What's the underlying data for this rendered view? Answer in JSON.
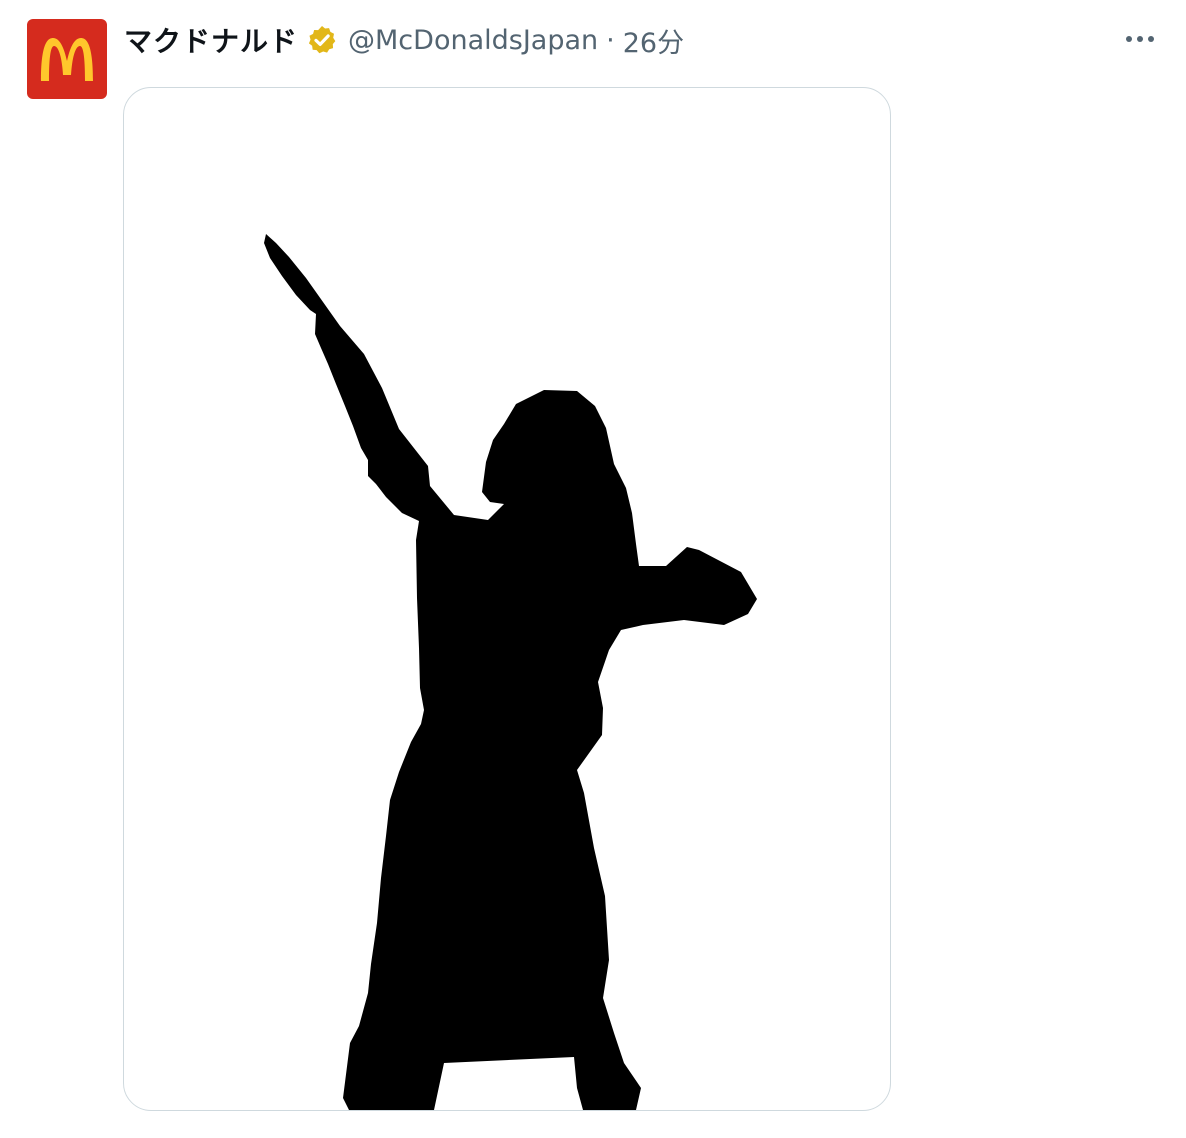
{
  "tweet": {
    "author": {
      "display_name": "マクドナルド",
      "handle": "@McDonaldsJapan",
      "avatar_icon": "mcdonalds-logo-icon",
      "verified_icon": "verified-gold-badge-icon"
    },
    "separator": "·",
    "timestamp": "26分",
    "more_icon": "more-horizontal-icon",
    "media": {
      "image_subject": "silhouette-icon"
    }
  },
  "colors": {
    "brand_red": "#d52b1e",
    "brand_yellow": "#ffc72c",
    "verified_gold": "#e2b719",
    "muted_text": "#536471",
    "primary_text": "#0f1419",
    "border": "#cfd9de"
  }
}
